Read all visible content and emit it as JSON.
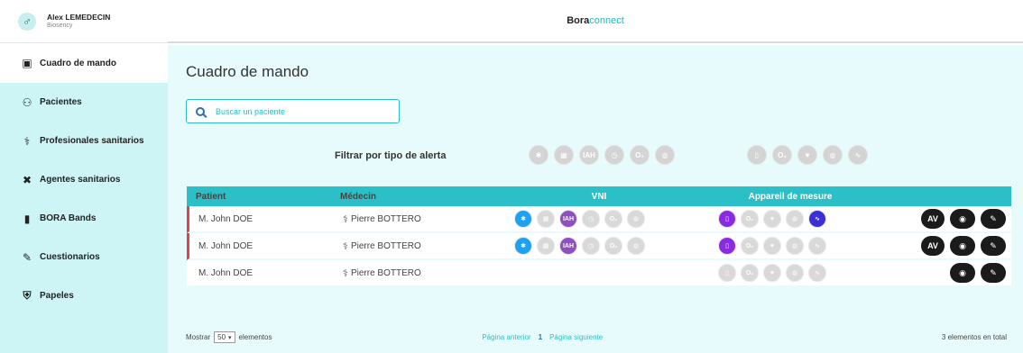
{
  "user": {
    "name": "Alex LEMEDECIN",
    "org": "Biosency",
    "avatar_symbol": "♂"
  },
  "sidebar": {
    "items": [
      {
        "label": "Cuadro de mando",
        "icon": "calendar-icon",
        "glyph": "▣"
      },
      {
        "label": "Pacientes",
        "icon": "user-icon",
        "glyph": "⚇"
      },
      {
        "label": "Profesionales sanitarios",
        "icon": "stethoscope-icon",
        "glyph": "⚕"
      },
      {
        "label": "Agentes sanitarios",
        "icon": "tools-icon",
        "glyph": "✖"
      },
      {
        "label": "BORA Bands",
        "icon": "band-icon",
        "glyph": "▮"
      },
      {
        "label": "Cuestionarios",
        "icon": "form-icon",
        "glyph": "✎"
      },
      {
        "label": "Papeles",
        "icon": "shield-icon",
        "glyph": "⛨"
      }
    ]
  },
  "header": {
    "brand_bold": "Bora",
    "brand_light": "connect"
  },
  "main": {
    "title": "Cuadro de mando",
    "search_placeholder": "Buscar un paciente",
    "filter_label": "Filtrar por tipo de alerta",
    "filter_vni_chips": [
      "✱",
      "▦",
      "IAH",
      "◷",
      "O₂",
      "◍"
    ],
    "filter_app_chips": [
      "▯",
      "O₂",
      "♥",
      "◍",
      "∿"
    ]
  },
  "table": {
    "headers": {
      "patient": "Patient",
      "doctor": "Médecin",
      "vni": "VNI",
      "device": "Appareil de mesure"
    },
    "rows": [
      {
        "patient": "M. John DOE",
        "doctor": "Pierre BOTTERO",
        "vni": [
          "✱",
          "▦",
          "IAH",
          "◷",
          "O₂",
          "◍"
        ],
        "device": [
          "▯",
          "O₂",
          "♥",
          "◍",
          "∿"
        ],
        "av": "AV"
      },
      {
        "patient": "M. John DOE",
        "doctor": "Pierre BOTTERO",
        "vni": [
          "✱",
          "▦",
          "IAH",
          "◷",
          "O₂",
          "◍"
        ],
        "device": [
          "▯",
          "O₂",
          "♥",
          "◍",
          "∿"
        ],
        "av": "AV"
      },
      {
        "patient": "M. John DOE",
        "doctor": "Pierre BOTTERO",
        "device": [
          "▯",
          "O₂",
          "♥",
          "◍",
          "∿"
        ]
      }
    ]
  },
  "footer": {
    "show_label": "Mostrar",
    "page_size": "50",
    "elements_label": "elementos",
    "prev": "Página anterior",
    "current_page": "1",
    "next": "Página siguiente",
    "total": "3 elementos en total"
  },
  "colors": {
    "accent": "#2bbfc7",
    "sidebar_bg": "#cdf5f5",
    "alert_red": "#e0434c",
    "chip_blue": "#1da1f2",
    "chip_purple": "#8e4fbf",
    "chip_violet": "#8a2be2",
    "chip_indigo": "#3b2fd6"
  }
}
